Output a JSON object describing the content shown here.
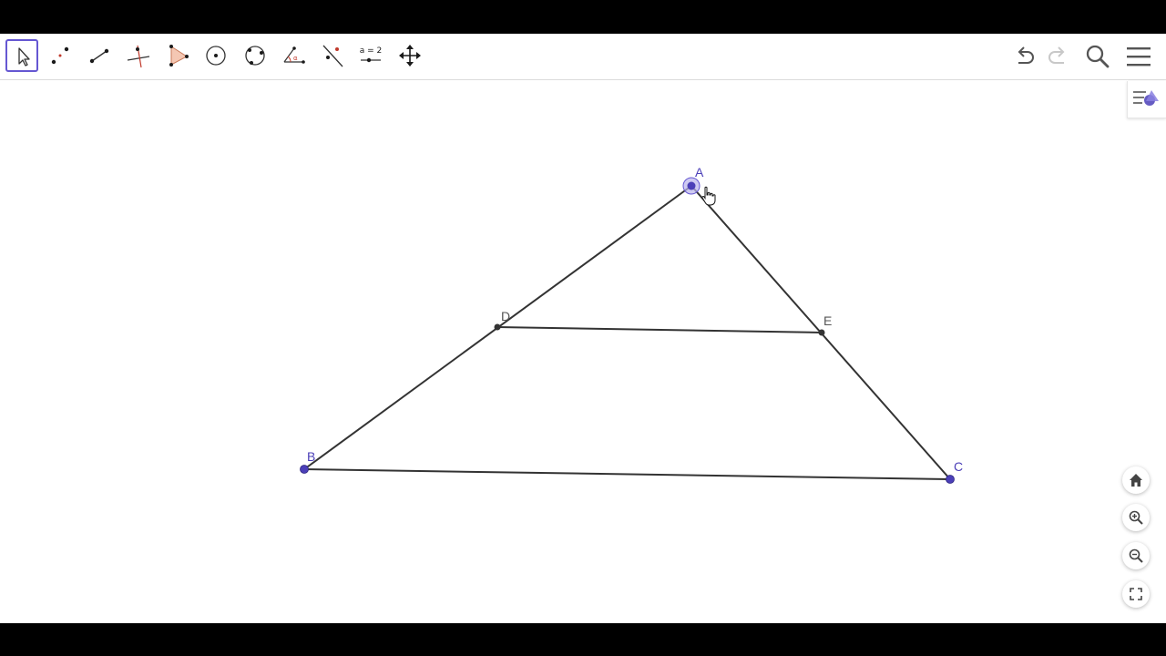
{
  "toolbar": {
    "tools": [
      {
        "name": "move-tool",
        "icon": "arrow-cursor-icon",
        "selected": true
      },
      {
        "name": "point-tool",
        "icon": "points-icon"
      },
      {
        "name": "segment-tool",
        "icon": "segment-icon"
      },
      {
        "name": "perpendicular-line-tool",
        "icon": "perpendicular-icon"
      },
      {
        "name": "polygon-tool",
        "icon": "polygon-icon"
      },
      {
        "name": "circle-center-point-tool",
        "icon": "circle-center-icon"
      },
      {
        "name": "circle-through-points-tool",
        "icon": "circle-three-points-icon"
      },
      {
        "name": "angle-tool",
        "icon": "angle-icon"
      },
      {
        "name": "reflect-tool",
        "icon": "reflect-icon"
      },
      {
        "name": "slider-tool",
        "icon": "slider-icon",
        "label": "a = 2"
      },
      {
        "name": "move-graphics-view-tool",
        "icon": "move-arrows-icon"
      }
    ],
    "right": [
      "undo-icon",
      "redo-icon",
      "search-icon",
      "menu-icon"
    ]
  },
  "construction": {
    "points": [
      {
        "label": "A",
        "color": "#4b3fb8",
        "selected": true
      },
      {
        "label": "B",
        "color": "#4b3fb8"
      },
      {
        "label": "C",
        "color": "#4b3fb8"
      },
      {
        "label": "D",
        "color": "#333333"
      },
      {
        "label": "E",
        "color": "#333333"
      }
    ],
    "segments": [
      "AB",
      "AC",
      "BC",
      "DE"
    ]
  },
  "zoom_controls": [
    "home-icon",
    "zoom-in-icon",
    "zoom-out-icon",
    "fullscreen-icon"
  ],
  "colors": {
    "accent": "#6557d2",
    "free_point": "#4b3fb8",
    "dependent_point": "#333333",
    "segment": "#333333",
    "polygon_fill": "#f4c7b3"
  }
}
